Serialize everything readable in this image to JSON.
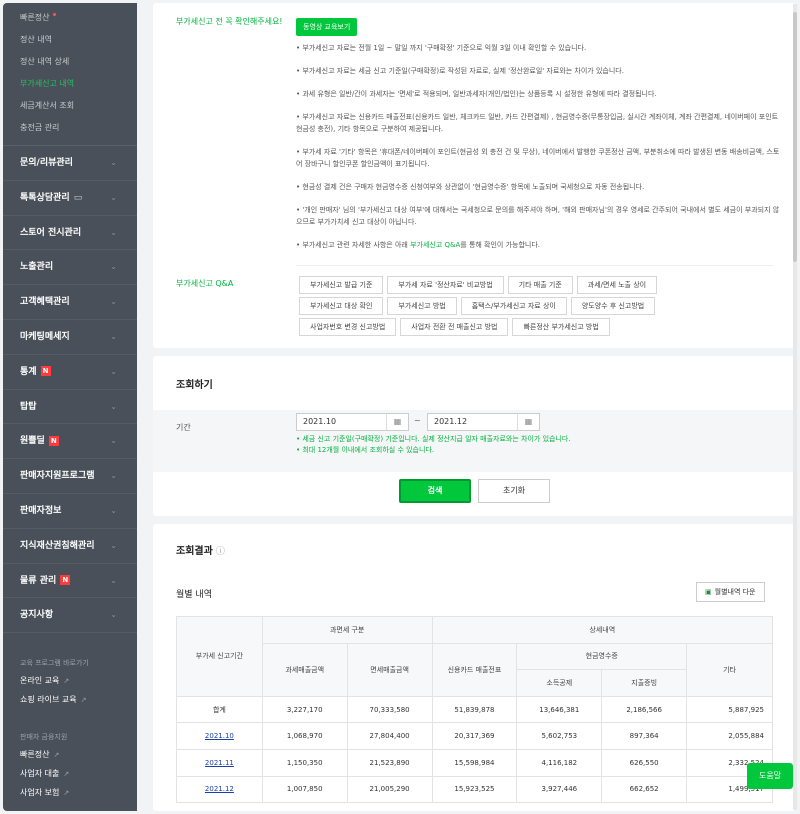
{
  "sidebar": {
    "sub_items": [
      {
        "label": "빠른정산"
      },
      {
        "label": "정산 내역"
      },
      {
        "label": "정산 내역 상세"
      },
      {
        "label": "부가세신고 내역"
      },
      {
        "label": "세금계산서 조회"
      },
      {
        "label": "충전금 관리"
      }
    ],
    "menu_items": [
      {
        "label": "문의/리뷰관리"
      },
      {
        "label": "톡톡상담관리"
      },
      {
        "label": "스토어 전시관리"
      },
      {
        "label": "노출관리"
      },
      {
        "label": "고객혜택관리"
      },
      {
        "label": "마케팅메세지"
      },
      {
        "label": "통계",
        "badge": "N"
      },
      {
        "label": "탑탑"
      },
      {
        "label": "원쁠딜",
        "badge": "N"
      },
      {
        "label": "판매자지원프로그램"
      },
      {
        "label": "판매자정보"
      },
      {
        "label": "지식재산권침해관리"
      },
      {
        "label": "물류 관리",
        "badge": "N"
      },
      {
        "label": "공지사항"
      }
    ],
    "edu_label": "교육 프로그램 바로가기",
    "edu_links": [
      {
        "label": "온라인 교육"
      },
      {
        "label": "쇼핑 라이브 교육"
      }
    ],
    "finance_label": "판매자 금융지원",
    "finance_links": [
      {
        "label": "빠른정산"
      },
      {
        "label": "사업자 대출"
      },
      {
        "label": "사업자 보험"
      }
    ]
  },
  "notice": {
    "title": "부가세신고 전 꼭 확인해주세요!",
    "video_button": "동영상 교육보기",
    "items": [
      "• 부가세신고 자료는 전월 1일 ~ 말일 까지 '구매확정' 기준으로 익월 3일 이내 확인할 수 있습니다.",
      "• 부가세신고 자료는 세금 신고 기준일(구매확정)로 작성된 자료로, 실제 '정산완료일' 자료와는 차이가 있습니다.",
      "• 과세 유형은 일반/간이 과세자는 '면세'로 적용되며, 일반과세자(개인/법인)는 상품등록 시 설정한 유형에 따라 결정됩니다.",
      "• 부가세신고 자료는 신용카드 매출전표(신용카드 일반, 체크카드 일반, 카드 간편결제) , 현금영수증(무통장입금, 실시간 계좌이체, 계좌 간편결제, 네이버페이 포인트 현금성 충전), 기타 항목으로 구분하여 제공됩니다.",
      "• 부가세 자료 '기타' 항목은 '휴대폰/네이버페이 포인트(현금성 외 충전 건 및 무상), 네이버에서 발행한 쿠폰정산 금액, 부분취소에 따라 발생된 변동 배송비금액, 스토어 장바구니 할인쿠폰 할인금액이 표기됩니다.",
      "• 현금성 결제 건은 구매자 현금영수증 신청여부와 상관없이 '현금영수증' 항목에 노출되며 국세청으로 자동 전송됩니다.",
      "• '개인 판매자' 님의 '부가세신고 대상 여부'에 대해서는 국세청으로 문의를 해주셔야 하며, '해외 판매자님'의 경우 영세로 간주되어 국내에서 별도 세금이 부과되지 않으므로 부가가치세 신고 대상이 아닙니다."
    ],
    "last_item_prefix": "• 부가세신고 관련 자세한 사항은 아래 ",
    "last_item_link": "부가세신고 Q&A",
    "last_item_suffix": "를 통해 확인이 가능합니다.",
    "qa_label": "부가세신고 Q&A",
    "qa_rows": [
      [
        {
          "label": "부가세신고 발급 기준"
        },
        {
          "label": "부가세 자료 '정산자료' 비교방법"
        },
        {
          "label": "기타 매출 기준"
        },
        {
          "label": "과세/면세 노출 상이"
        }
      ],
      [
        {
          "label": "부가세신고 대상 확인"
        },
        {
          "label": "부가세신고 방법"
        },
        {
          "label": "홈택스/부가세신고 자료 상이"
        },
        {
          "label": "양도양수 후 신고방법"
        }
      ],
      [
        {
          "label": "사업자번호 변경 신고방법"
        },
        {
          "label": "사업자 전환 전 매출신고 방법"
        },
        {
          "label": "빠른정산 부가세신고 방법"
        }
      ]
    ]
  },
  "search": {
    "title": "조회하기",
    "period_label": "기간",
    "start_value": "2021.10",
    "end_value": "2021.12",
    "tilde": "~",
    "hint1": "• 세금 신고 기준일(구매확정) 기준입니다. 실제 정산지급 일자 매출자료와는 차이가 있습니다.",
    "hint2": "• 최대 12개월 이내에서 조회하실 수 있습니다.",
    "search_button": "검색",
    "reset_button": "초기화"
  },
  "results": {
    "title": "조회결과",
    "monthly_label": "월별 내역",
    "download_button": "월별내역 다운",
    "headers": {
      "period": "부가세 신고기간",
      "tax_group": "과면세 구분",
      "taxable": "과세매출금액",
      "exempt": "면세매출금액",
      "detail_group": "상세내역",
      "credit": "신용카드 매출전표",
      "cash_group": "현금영수증",
      "income": "소득공제",
      "expense": "지출증빙",
      "other": "기타"
    },
    "rows": [
      {
        "period": "합계",
        "taxable": "3,227,170",
        "exempt": "70,333,580",
        "credit": "51,839,878",
        "income": "13,646,381",
        "expense": "2,186,566",
        "other": "5,887,925"
      },
      {
        "period": "2021.10",
        "taxable": "1,068,970",
        "exempt": "27,804,400",
        "credit": "20,317,369",
        "income": "5,602,753",
        "expense": "897,364",
        "other": "2,055,884"
      },
      {
        "period": "2021.11",
        "taxable": "1,150,350",
        "exempt": "21,523,890",
        "credit": "15,598,984",
        "income": "4,116,182",
        "expense": "626,550",
        "other": "2,332,524"
      },
      {
        "period": "2021.12",
        "taxable": "1,007,850",
        "exempt": "21,005,290",
        "credit": "15,923,525",
        "income": "3,927,446",
        "expense": "662,652",
        "other": "1,499,517"
      }
    ]
  },
  "help_button": "도움말"
}
